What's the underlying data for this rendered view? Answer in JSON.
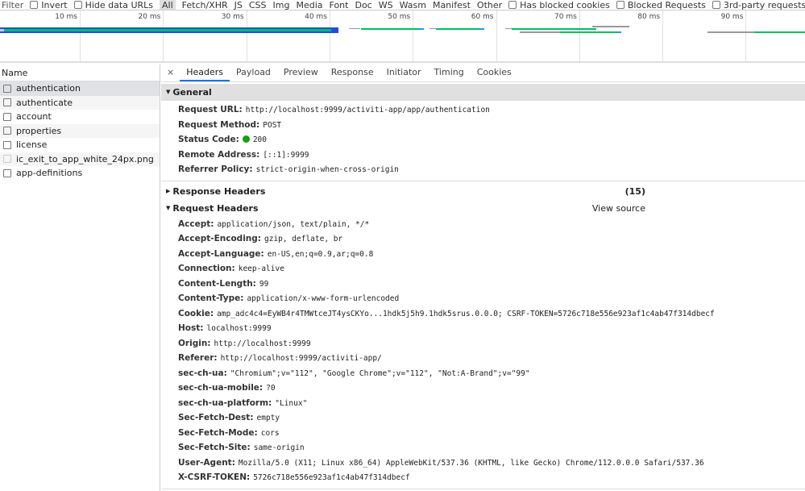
{
  "filterbar": {
    "filter_placeholder": "Filter",
    "invert": "Invert",
    "hide_data_urls": "Hide data URLs",
    "types": [
      "All",
      "Fetch/XHR",
      "JS",
      "CSS",
      "Img",
      "Media",
      "Font",
      "Doc",
      "WS",
      "Wasm",
      "Manifest",
      "Other"
    ],
    "has_blocked_cookies": "Has blocked cookies",
    "blocked_requests": "Blocked Requests",
    "third_party": "3rd-party requests"
  },
  "timeline": {
    "ticks": [
      "10 ms",
      "20 ms",
      "30 ms",
      "40 ms",
      "50 ms",
      "60 ms",
      "70 ms",
      "80 ms",
      "90 ms"
    ]
  },
  "requests": {
    "header": "Name",
    "items": [
      "authentication",
      "authenticate",
      "account",
      "properties",
      "license",
      "ic_exit_to_app_white_24px.png",
      "app-definitions"
    ]
  },
  "tabs": {
    "close": "×",
    "items": [
      "Headers",
      "Payload",
      "Preview",
      "Response",
      "Initiator",
      "Timing",
      "Cookies"
    ],
    "active": "Headers"
  },
  "general": {
    "title": "General",
    "rows": [
      {
        "k": "Request URL:",
        "v": "http://localhost:9999/activiti-app/app/authentication"
      },
      {
        "k": "Request Method:",
        "v": "POST"
      },
      {
        "k": "Status Code:",
        "v": "200"
      },
      {
        "k": "Remote Address:",
        "v": "[::1]:9999"
      },
      {
        "k": "Referrer Policy:",
        "v": "strict-origin-when-cross-origin"
      }
    ]
  },
  "response_headers": {
    "title": "Response Headers",
    "count": "(15)"
  },
  "request_headers": {
    "title": "Request Headers",
    "view_source": "View source",
    "rows": [
      {
        "k": "Accept:",
        "v": "application/json, text/plain, */*"
      },
      {
        "k": "Accept-Encoding:",
        "v": "gzip, deflate, br"
      },
      {
        "k": "Accept-Language:",
        "v": "en-US,en;q=0.9,ar;q=0.8"
      },
      {
        "k": "Connection:",
        "v": "keep-alive"
      },
      {
        "k": "Content-Length:",
        "v": "99"
      },
      {
        "k": "Content-Type:",
        "v": "application/x-www-form-urlencoded"
      },
      {
        "k": "Cookie:",
        "v": "amp_adc4c4=EyWB4r4TMWtceJT4ysCKYo...1hdk5j5h9.1hdk5srus.0.0.0; CSRF-TOKEN=5726c718e556e923af1c4ab47f314dbecf"
      },
      {
        "k": "Host:",
        "v": "localhost:9999"
      },
      {
        "k": "Origin:",
        "v": "http://localhost:9999"
      },
      {
        "k": "Referer:",
        "v": "http://localhost:9999/activiti-app/"
      },
      {
        "k": "sec-ch-ua:",
        "v": "\"Chromium\";v=\"112\", \"Google Chrome\";v=\"112\", \"Not:A-Brand\";v=\"99\""
      },
      {
        "k": "sec-ch-ua-mobile:",
        "v": "?0"
      },
      {
        "k": "sec-ch-ua-platform:",
        "v": "\"Linux\""
      },
      {
        "k": "Sec-Fetch-Dest:",
        "v": "empty"
      },
      {
        "k": "Sec-Fetch-Mode:",
        "v": "cors"
      },
      {
        "k": "Sec-Fetch-Site:",
        "v": "same-origin"
      },
      {
        "k": "User-Agent:",
        "v": "Mozilla/5.0 (X11; Linux x86_64) AppleWebKit/537.36 (KHTML, like Gecko) Chrome/112.0.0.0 Safari/537.36"
      },
      {
        "k": "X-CSRF-TOKEN:",
        "v": "5726c718e556e923af1c4ab47f314dbecf"
      }
    ]
  },
  "colors": {
    "accent": "#1a73e8",
    "status_ok": "#0ca30c",
    "waterfall_green": "#00c060",
    "waterfall_blue": "#1e50e0"
  }
}
